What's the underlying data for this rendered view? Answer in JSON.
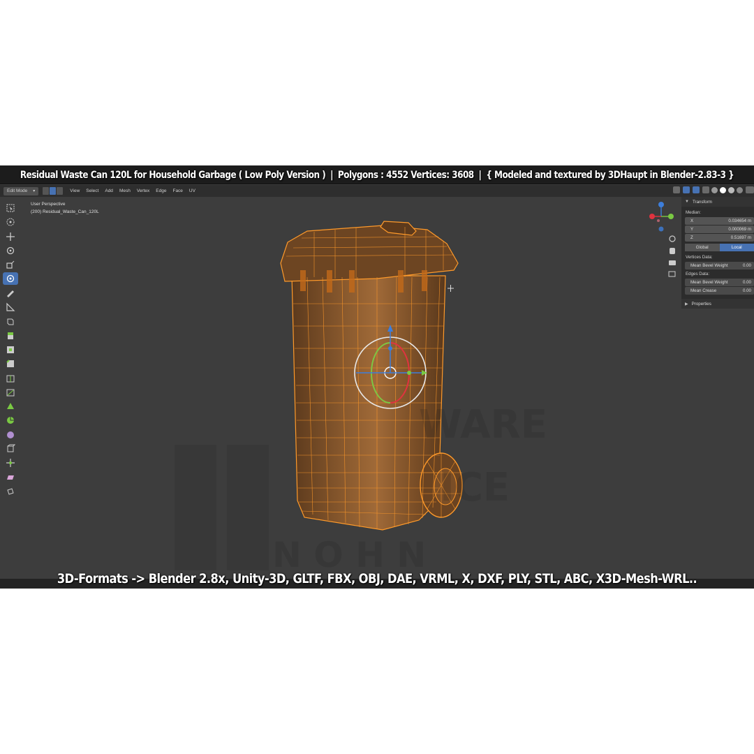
{
  "overlay": {
    "title": "Residual Waste Can 120L for Household Garbage ( Low Poly Version )",
    "sep1": "|",
    "polygons": "Polygons : 4552  Vertices: 3608",
    "sep2": "|",
    "credit": "{ Modeled and textured by 3DHaupt in Blender-2.83-3 }",
    "formats": "3D-Formats -> Blender 2.8x, Unity-3D, GLTF, FBX, OBJ, DAE, VRML, X, DXF, PLY, STL, ABC, X3D-Mesh-WRL.."
  },
  "header": {
    "mode": "Edit Mode",
    "menus": [
      "View",
      "Select",
      "Add",
      "Mesh",
      "Vertex",
      "Edge",
      "Face",
      "UV"
    ]
  },
  "viewport": {
    "perspective": "User Perspective",
    "object": "(200) Residual_Waste_Can_120L"
  },
  "npanel": {
    "tab_title": "Transform",
    "median_label": "Median:",
    "x_label": "X",
    "x_value": "0.034654 m",
    "y_label": "Y",
    "y_value": "0.000069 m",
    "z_label": "Z",
    "z_value": "0.51697 m",
    "global": "Global",
    "local": "Local",
    "vertices_data": "Vertices Data:",
    "mean_bevel_weight_label": "Mean Bevel Weight",
    "mean_bevel_weight_value": "0.00",
    "edges_data": "Edges Data:",
    "edge_bevel_weight_label": "Mean Bevel Weight",
    "edge_bevel_weight_value": "0.00",
    "mean_crease_label": "Mean Crease",
    "mean_crease_value": "0.00",
    "properties": "Properties"
  },
  "colors": {
    "wire": "#ff8c1a",
    "body": "#7a5028",
    "select_active": "#4772b3",
    "axis_x": "#e0333f",
    "axis_y": "#7ac943",
    "axis_z": "#3d7edb"
  }
}
